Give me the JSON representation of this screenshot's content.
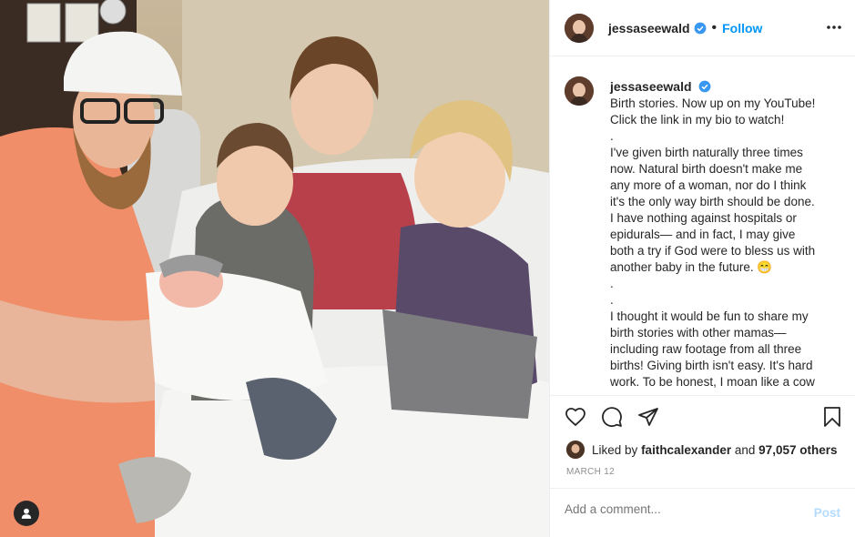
{
  "post": {
    "username": "jessaseewald",
    "follow_label": "Follow",
    "caption_lines": [
      "Birth stories. Now up on my YouTube!",
      "Click the link in my bio to watch!",
      ".",
      "I've given birth naturally three times",
      "now. Natural birth doesn't make me",
      "any more of a woman, nor do I think",
      "it's the only way birth should be done.",
      "I have nothing against hospitals or",
      "epidurals— and in fact, I may give",
      "both a try if God were to bless us with",
      "another baby in the future. 😁",
      ".",
      ".",
      "I thought it would be fun to share my",
      "birth stories with other mamas—",
      "including raw footage from all three",
      "births! Giving birth isn't easy. It's hard",
      "work. To be honest, I moan like a cow"
    ],
    "liked_by_prefix": "Liked by",
    "liked_by_user": "faithcalexander",
    "liked_by_and": "and",
    "likes_count": "97,057 others",
    "date": "MARCH 12",
    "comment_placeholder": "Add a comment...",
    "post_label": "Post"
  },
  "colors": {
    "accent": "#0095f6",
    "verified": "#3897f0",
    "muted": "#8e8e8e",
    "post_disabled": "#b3dbff"
  },
  "icons": [
    "user-tag-icon",
    "verified-icon",
    "more-icon",
    "heart-icon",
    "comment-icon",
    "share-icon",
    "bookmark-icon"
  ]
}
